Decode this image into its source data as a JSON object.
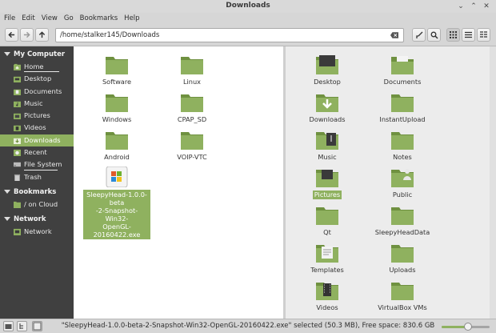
{
  "window": {
    "title": "Downloads"
  },
  "menu": [
    "File",
    "Edit",
    "View",
    "Go",
    "Bookmarks",
    "Help"
  ],
  "location": {
    "path": "/home/stalker145/Downloads"
  },
  "sidebar": {
    "computer_heading": "My Computer",
    "computer_items": [
      {
        "label": "Home",
        "icon": "home-folder-icon"
      },
      {
        "label": "Desktop",
        "icon": "desktop-folder-icon"
      },
      {
        "label": "Documents",
        "icon": "documents-folder-icon"
      },
      {
        "label": "Music",
        "icon": "music-folder-icon"
      },
      {
        "label": "Pictures",
        "icon": "pictures-folder-icon"
      },
      {
        "label": "Videos",
        "icon": "videos-folder-icon"
      },
      {
        "label": "Downloads",
        "icon": "downloads-folder-icon"
      },
      {
        "label": "Recent",
        "icon": "recent-icon"
      },
      {
        "label": "File System",
        "icon": "drive-icon"
      },
      {
        "label": "Trash",
        "icon": "trash-icon"
      }
    ],
    "bookmarks_heading": "Bookmarks",
    "bookmark_items": [
      {
        "label": "/ on Cloud",
        "icon": "folder-icon"
      }
    ],
    "network_heading": "Network",
    "network_items": [
      {
        "label": "Network",
        "icon": "network-icon"
      }
    ]
  },
  "left_pane": {
    "files": [
      {
        "name": "Software",
        "type": "folder"
      },
      {
        "name": "Linux",
        "type": "folder"
      },
      {
        "name": "Windows",
        "type": "folder"
      },
      {
        "name": "CPAP_SD",
        "type": "folder"
      },
      {
        "name": "Android",
        "type": "folder"
      },
      {
        "name": "VOIP-VTC",
        "type": "folder"
      },
      {
        "name": "SleepyHead-1.0.0-beta-2-Snapshot-Win32-OpenGL-20160422.exe",
        "name_lines": [
          "SleepyHead-1.0.0-beta",
          "-2-Snapshot-Win32-",
          "OpenGL-20160422.exe"
        ],
        "type": "exe",
        "selected": true
      }
    ]
  },
  "right_pane": {
    "files": [
      {
        "name": "Desktop",
        "icon": "desktop"
      },
      {
        "name": "Documents",
        "icon": "documents"
      },
      {
        "name": "Downloads",
        "icon": "downloads"
      },
      {
        "name": "InstantUpload",
        "icon": "folder"
      },
      {
        "name": "Music",
        "icon": "music"
      },
      {
        "name": "Notes",
        "icon": "folder"
      },
      {
        "name": "Pictures",
        "icon": "pictures",
        "highlighted": true
      },
      {
        "name": "Public",
        "icon": "public"
      },
      {
        "name": "Qt",
        "icon": "folder"
      },
      {
        "name": "SleepyHeadData",
        "icon": "folder"
      },
      {
        "name": "Templates",
        "icon": "templates"
      },
      {
        "name": "Uploads",
        "icon": "folder"
      },
      {
        "name": "Videos",
        "icon": "videos"
      },
      {
        "name": "VirtualBox VMs",
        "icon": "folder"
      }
    ]
  },
  "status": {
    "text": "\"SleepyHead-1.0.0-beta-2-Snapshot-Win32-OpenGL-20160422.exe\" selected (50.3 MB), Free space: 830.6 GB"
  },
  "zoom": {
    "level_fraction": 0.5
  },
  "colors": {
    "accent": "#8fb15f",
    "sidebar_bg": "#404040",
    "folder": "#86ad4f"
  }
}
